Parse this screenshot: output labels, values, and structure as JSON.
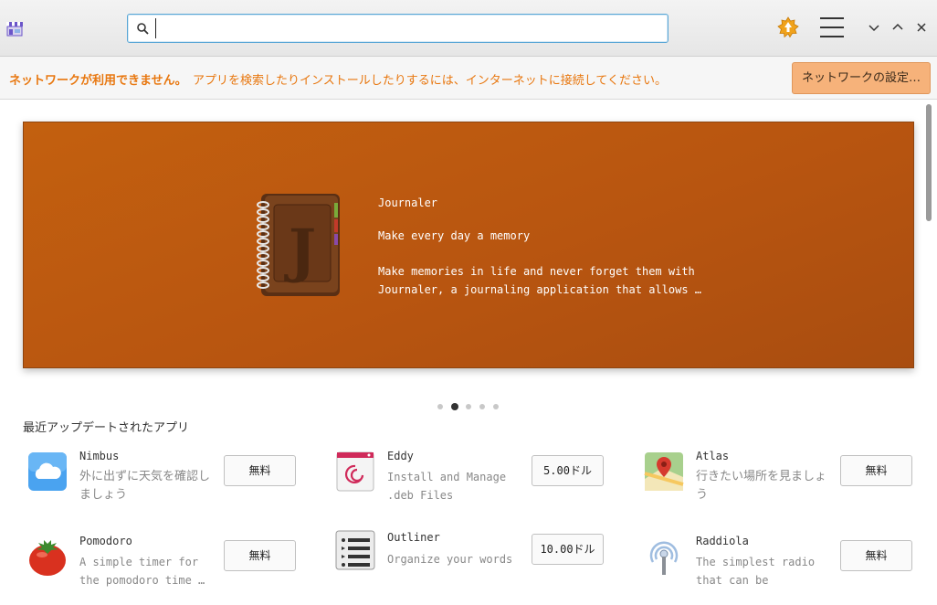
{
  "header": {
    "search_value": "",
    "search_placeholder": ""
  },
  "infobar": {
    "bold_text": "ネットワークが利用できません。",
    "text": "アプリを検索したりインストールしたりするには、インターネットに接続してください。",
    "button_label": "ネットワークの設定…"
  },
  "banner": {
    "title": "Journaler",
    "summary": "Make every day a memory",
    "description": "Make memories in life and never forget them with Journaler, a journaling application that allows …",
    "page_count": 5,
    "active_page": 1,
    "colors": {
      "background": "#b85510"
    }
  },
  "recent": {
    "title": "最近アップデートされたアプリ",
    "apps": [
      {
        "name": "Nimbus",
        "summary": "外に出ずに天気を確認しましょう",
        "price": "無料",
        "icon": "cloud-icon"
      },
      {
        "name": "Eddy",
        "summary": "Install and Manage .deb Files",
        "price": "5.00ドル",
        "icon": "debian-icon"
      },
      {
        "name": "Atlas",
        "summary": "行きたい場所を見ましょう",
        "price": "無料",
        "icon": "map-pin-icon"
      },
      {
        "name": "Pomodoro",
        "summary": "A simple timer for the pomodoro time …",
        "price": "無料",
        "icon": "tomato-icon"
      },
      {
        "name": "Outliner",
        "summary": "Organize your words",
        "price": "10.00ドル",
        "icon": "outline-list-icon"
      },
      {
        "name": "Raddiola",
        "summary": "The simplest radio that can be",
        "price": "無料",
        "icon": "radio-icon"
      }
    ]
  },
  "colors": {
    "accent": "#e8770f",
    "network_button": "#f6b27a",
    "focus_ring": "#5aa7d6"
  }
}
